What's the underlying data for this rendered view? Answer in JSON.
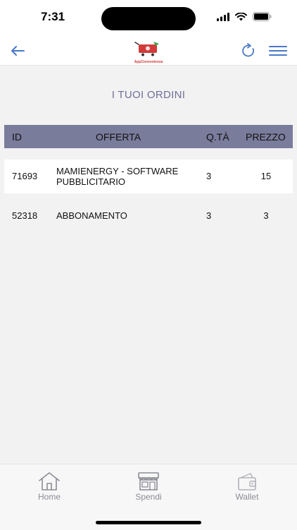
{
  "status_bar": {
    "time": "7:31"
  },
  "header": {
    "back_icon": "arrow-left-icon",
    "logo_text": "AppConvenienza",
    "refresh_icon": "refresh-icon",
    "menu_icon": "hamburger-menu-icon",
    "accent_color": "#4a78c8"
  },
  "page": {
    "title": "I TUOI ORDINI"
  },
  "table": {
    "header_color": "#7a7c9c",
    "columns": {
      "id": "ID",
      "offer": "OFFERTA",
      "qty": "Q.TÀ",
      "price": "PREZZO"
    },
    "rows": [
      {
        "id": "71693",
        "offer": "MAMIENERGY - SOFTWARE PUBBLICITARIO",
        "qty": "3",
        "price": "15"
      },
      {
        "id": "52318",
        "offer": "ABBONAMENTO",
        "qty": "3",
        "price": "3"
      }
    ]
  },
  "tab_bar": {
    "tabs": [
      {
        "label": "Home",
        "icon": "home-icon"
      },
      {
        "label": "Spendi",
        "icon": "shop-icon"
      },
      {
        "label": "Wallet",
        "icon": "wallet-icon"
      }
    ]
  }
}
